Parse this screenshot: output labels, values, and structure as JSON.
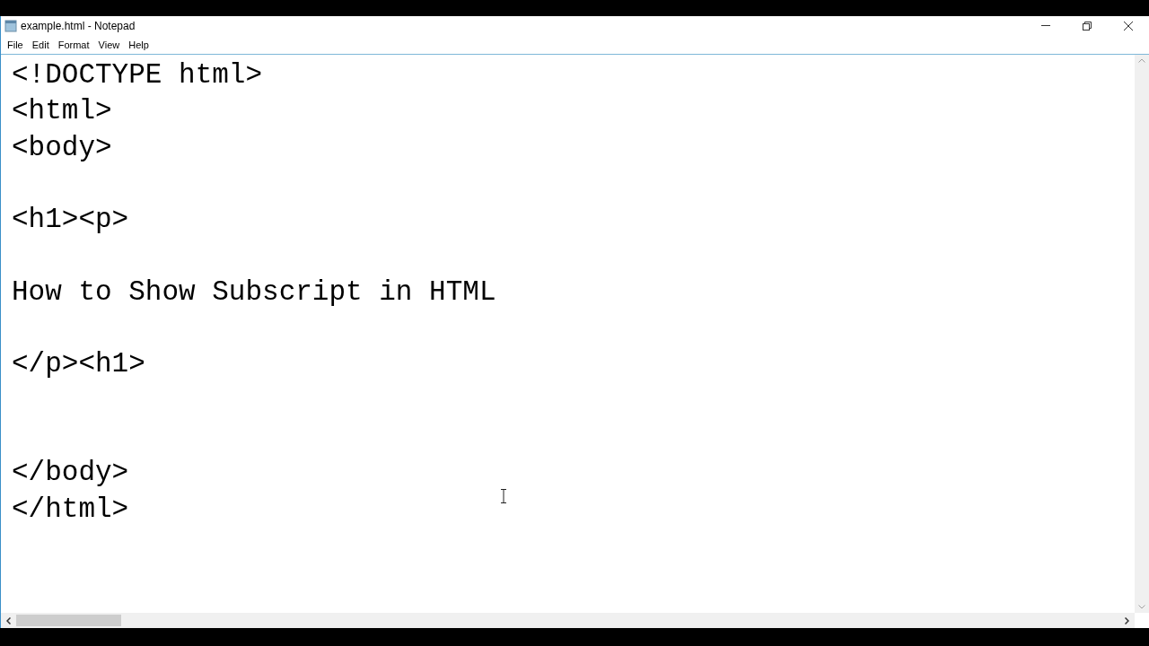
{
  "window": {
    "title": "example.html - Notepad"
  },
  "menu": [
    "File",
    "Edit",
    "Format",
    "View",
    "Help"
  ],
  "editor": {
    "lines": [
      {
        "kind": "text",
        "text": "<!DOCTYPE html>"
      },
      {
        "kind": "text",
        "text": "<html>"
      },
      {
        "kind": "text",
        "text": "<body>"
      },
      {
        "kind": "blank"
      },
      {
        "kind": "text",
        "text": "<h1><p>"
      },
      {
        "kind": "blank"
      },
      {
        "kind": "text",
        "text": "How to Show Subscript in HTML"
      },
      {
        "kind": "blank"
      },
      {
        "kind": "text",
        "text": "</p><h1>"
      },
      {
        "kind": "blank"
      },
      {
        "kind": "blank"
      },
      {
        "kind": "text",
        "text": "</body>"
      },
      {
        "kind": "text",
        "text": "</html>"
      }
    ]
  }
}
